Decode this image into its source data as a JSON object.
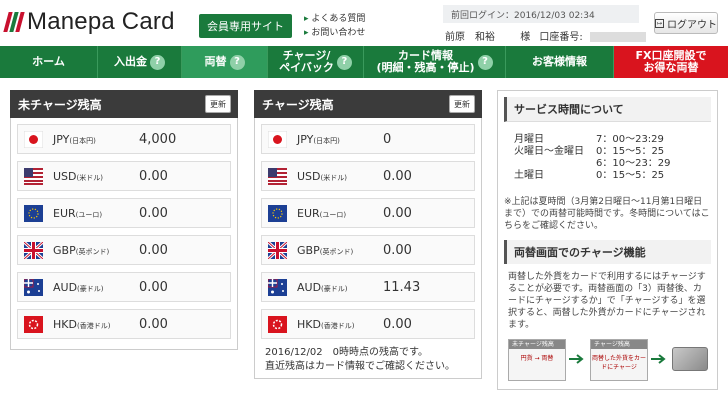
{
  "header": {
    "logo_text": "Manepa Card",
    "member_badge": "会員専用サイト",
    "faq_link": "よくある質問",
    "contact_link": "お問い合わせ",
    "last_login": "前回ログイン：2016/12/03 02:34",
    "user_name": "前原　和裕",
    "user_suffix": "様",
    "account_label": "口座番号:",
    "logout_label": "ログアウト"
  },
  "nav": {
    "home": "ホーム",
    "deposit": "入出金",
    "exchange": "両替",
    "charge_line1": "チャージ/",
    "charge_line2": "ペイバック",
    "card_line1": "カード情報",
    "card_line2": "(明細・残高・停止)",
    "customer": "お客様情報",
    "fx_line1": "FX口座開設で",
    "fx_line2": "お得な両替",
    "help_glyph": "?"
  },
  "uncharged": {
    "title": "未チャージ残高",
    "refresh_label": "更新",
    "rows": [
      {
        "code": "JPY",
        "name": "(日本円)",
        "amount": "4,000"
      },
      {
        "code": "USD",
        "name": "(米ドル)",
        "amount": "0.00"
      },
      {
        "code": "EUR",
        "name": "(ユーロ)",
        "amount": "0.00"
      },
      {
        "code": "GBP",
        "name": "(英ポンド)",
        "amount": "0.00"
      },
      {
        "code": "AUD",
        "name": "(豪ドル)",
        "amount": "0.00"
      },
      {
        "code": "HKD",
        "name": "(香港ドル)",
        "amount": "0.00"
      }
    ]
  },
  "charged": {
    "title": "チャージ残高",
    "refresh_label": "更新",
    "rows": [
      {
        "code": "JPY",
        "name": "(日本円)",
        "amount": "0"
      },
      {
        "code": "USD",
        "name": "(米ドル)",
        "amount": "0.00"
      },
      {
        "code": "EUR",
        "name": "(ユーロ)",
        "amount": "0.00"
      },
      {
        "code": "GBP",
        "name": "(英ポンド)",
        "amount": "0.00"
      },
      {
        "code": "AUD",
        "name": "(豪ドル)",
        "amount": "11.43"
      },
      {
        "code": "HKD",
        "name": "(香港ドル)",
        "amount": "0.00"
      }
    ],
    "note_line1": "2016/12/02　0時時点の残高です。",
    "note_line2": "直近残高はカード情報でご確認ください。"
  },
  "service": {
    "title": "サービス時間について",
    "hours": [
      {
        "day": "月曜日",
        "time": "7：00〜23:29"
      },
      {
        "day": "火曜日〜金曜日",
        "time": "0：15〜5：25"
      },
      {
        "day": "",
        "time": "6：10〜23：29"
      },
      {
        "day": "土曜日",
        "time": "0：15〜5：25"
      }
    ],
    "note": "※上記は夏時間（3月第2日曜日〜11月第1日曜日まで）での両替可能時間です。冬時間についてはこちらをご確認ください。",
    "charge_title": "両替画面でのチャージ機能",
    "charge_text": "両替した外貨をカードで利用するにはチャージすることが必要です。両替画面の「3）両替後、カードにチャージするか」で「チャージする」を選択すると、両替した外貨がカードにチャージされます。",
    "diagram_box1": "未チャージ残高",
    "diagram_box2": "チャージ残高",
    "diagram_box1_text": "円貨 → 両替",
    "diagram_box2_text": "両替した外貨をカードにチャージ"
  },
  "colors": {
    "brand_green": "#1a7a3c",
    "brand_red": "#d9141e",
    "panel_header": "#3b3b3b"
  }
}
